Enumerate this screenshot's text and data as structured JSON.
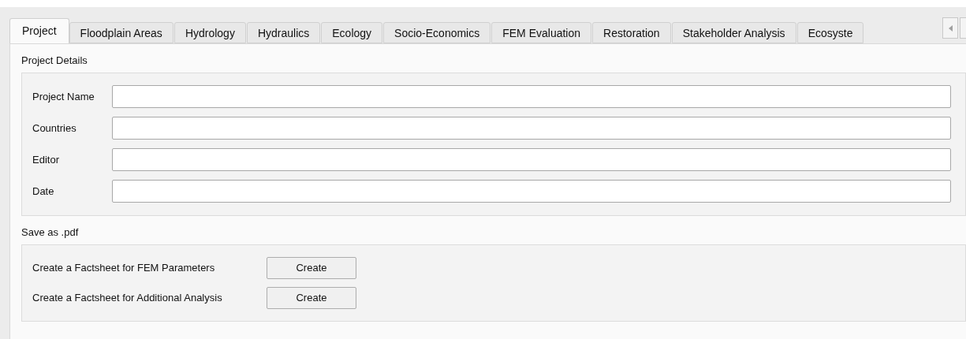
{
  "tabs": [
    {
      "label": "Project",
      "selected": true
    },
    {
      "label": "Floodplain Areas",
      "selected": false
    },
    {
      "label": "Hydrology",
      "selected": false
    },
    {
      "label": "Hydraulics",
      "selected": false
    },
    {
      "label": "Ecology",
      "selected": false
    },
    {
      "label": "Socio-Economics",
      "selected": false
    },
    {
      "label": "FEM Evaluation",
      "selected": false
    },
    {
      "label": "Restoration",
      "selected": false
    },
    {
      "label": "Stakeholder Analysis",
      "selected": false
    },
    {
      "label": "Ecosyste",
      "selected": false
    }
  ],
  "project_details": {
    "title": "Project Details",
    "fields": [
      {
        "label": "Project Name"
      },
      {
        "label": "Countries"
      },
      {
        "label": "Editor"
      },
      {
        "label": "Date"
      }
    ]
  },
  "save_as_pdf": {
    "title": "Save as .pdf",
    "rows": [
      {
        "label": "Create a Factsheet for FEM Parameters",
        "button": "Create"
      },
      {
        "label": "Create a Factsheet for Additional Analysis",
        "button": "Create"
      }
    ]
  }
}
